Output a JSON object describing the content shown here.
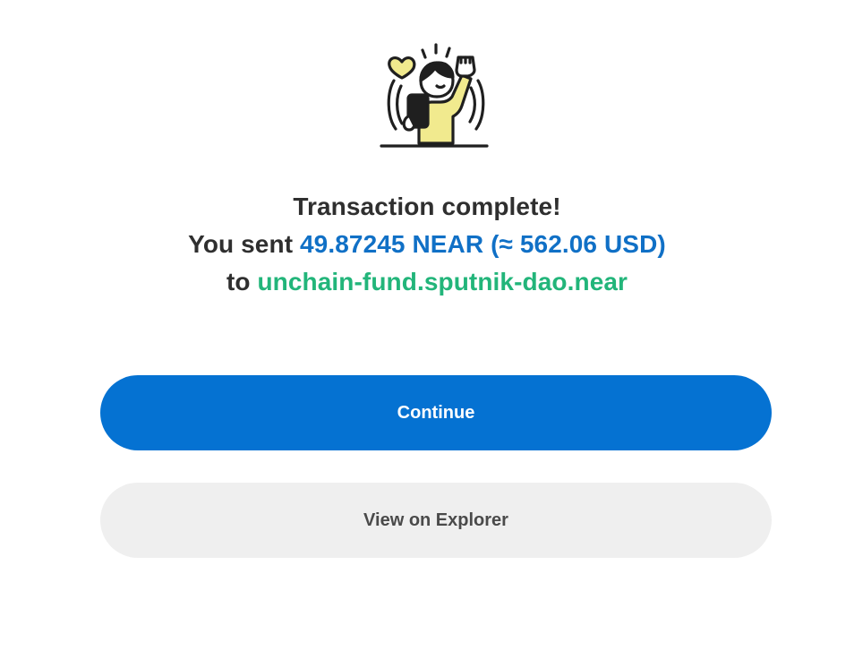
{
  "illustration": {
    "icon": "celebrating-person-icon",
    "accent_color": "#f1ea8e"
  },
  "message": {
    "title": "Transaction complete!",
    "sent_prefix": "You sent ",
    "amount": "49.87245 NEAR (≈ 562.06 USD)",
    "to_prefix": "to ",
    "recipient": "unchain-fund.sputnik-dao.near"
  },
  "buttons": {
    "continue_label": "Continue",
    "explorer_label": "View on Explorer"
  },
  "colors": {
    "primary": "#0572d2",
    "amount": "#1070c6",
    "recipient": "#22b57a",
    "secondary_bg": "#efefef"
  }
}
